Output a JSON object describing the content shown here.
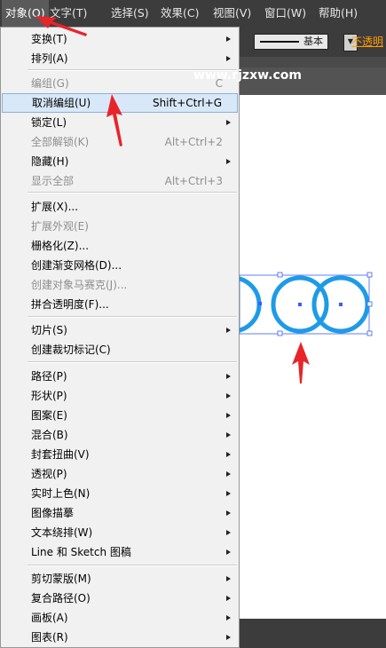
{
  "menubar": {
    "items": [
      "对象(O)",
      "文字(T)",
      "选择(S)",
      "效果(C)",
      "视图(V)",
      "窗口(W)",
      "帮助(H)"
    ]
  },
  "control_bar": {
    "stroke_style": "基本",
    "opacity_label": "不透明"
  },
  "watermark": "www.rjzxw.com",
  "menu": {
    "items": [
      {
        "label": "变换(T)",
        "shortcut": "",
        "submenu": true,
        "disabled": false,
        "highlighted": false
      },
      {
        "label": "排列(A)",
        "shortcut": "",
        "submenu": true,
        "disabled": false,
        "highlighted": false
      },
      {
        "label": "编组(G)",
        "shortcut": "C",
        "submenu": false,
        "disabled": true,
        "highlighted": false
      },
      {
        "label": "取消编组(U)",
        "shortcut": "Shift+Ctrl+G",
        "submenu": false,
        "disabled": false,
        "highlighted": true
      },
      {
        "label": "锁定(L)",
        "shortcut": "",
        "submenu": true,
        "disabled": false,
        "highlighted": false
      },
      {
        "label": "全部解锁(K)",
        "shortcut": "Alt+Ctrl+2",
        "submenu": false,
        "disabled": true,
        "highlighted": false
      },
      {
        "label": "隐藏(H)",
        "shortcut": "",
        "submenu": true,
        "disabled": false,
        "highlighted": false
      },
      {
        "label": "显示全部",
        "shortcut": "Alt+Ctrl+3",
        "submenu": false,
        "disabled": true,
        "highlighted": false
      },
      {
        "label": "扩展(X)...",
        "shortcut": "",
        "submenu": false,
        "disabled": false,
        "highlighted": false
      },
      {
        "label": "扩展外观(E)",
        "shortcut": "",
        "submenu": false,
        "disabled": true,
        "highlighted": false
      },
      {
        "label": "栅格化(Z)...",
        "shortcut": "",
        "submenu": false,
        "disabled": false,
        "highlighted": false
      },
      {
        "label": "创建渐变网格(D)...",
        "shortcut": "",
        "submenu": false,
        "disabled": false,
        "highlighted": false
      },
      {
        "label": "创建对象马赛克(J)...",
        "shortcut": "",
        "submenu": false,
        "disabled": true,
        "highlighted": false
      },
      {
        "label": "拼合透明度(F)...",
        "shortcut": "",
        "submenu": false,
        "disabled": false,
        "highlighted": false
      },
      {
        "label": "切片(S)",
        "shortcut": "",
        "submenu": true,
        "disabled": false,
        "highlighted": false
      },
      {
        "label": "创建裁切标记(C)",
        "shortcut": "",
        "submenu": false,
        "disabled": false,
        "highlighted": false
      },
      {
        "label": "路径(P)",
        "shortcut": "",
        "submenu": true,
        "disabled": false,
        "highlighted": false
      },
      {
        "label": "形状(P)",
        "shortcut": "",
        "submenu": true,
        "disabled": false,
        "highlighted": false
      },
      {
        "label": "图案(E)",
        "shortcut": "",
        "submenu": true,
        "disabled": false,
        "highlighted": false
      },
      {
        "label": "混合(B)",
        "shortcut": "",
        "submenu": true,
        "disabled": false,
        "highlighted": false
      },
      {
        "label": "封套扭曲(V)",
        "shortcut": "",
        "submenu": true,
        "disabled": false,
        "highlighted": false
      },
      {
        "label": "透视(P)",
        "shortcut": "",
        "submenu": true,
        "disabled": false,
        "highlighted": false
      },
      {
        "label": "实时上色(N)",
        "shortcut": "",
        "submenu": true,
        "disabled": false,
        "highlighted": false
      },
      {
        "label": "图像描摹",
        "shortcut": "",
        "submenu": true,
        "disabled": false,
        "highlighted": false
      },
      {
        "label": "文本绕排(W)",
        "shortcut": "",
        "submenu": true,
        "disabled": false,
        "highlighted": false
      },
      {
        "label": "Line 和 Sketch 图稿",
        "shortcut": "",
        "submenu": true,
        "disabled": false,
        "highlighted": false
      },
      {
        "label": "剪切蒙版(M)",
        "shortcut": "",
        "submenu": true,
        "disabled": false,
        "highlighted": false
      },
      {
        "label": "复合路径(O)",
        "shortcut": "",
        "submenu": true,
        "disabled": false,
        "highlighted": false
      },
      {
        "label": "画板(A)",
        "shortcut": "",
        "submenu": true,
        "disabled": false,
        "highlighted": false
      },
      {
        "label": "图表(R)",
        "shortcut": "",
        "submenu": true,
        "disabled": false,
        "highlighted": false
      }
    ]
  },
  "colors": {
    "circle_stroke": "#1e9be6",
    "selection": "#3a5cff",
    "annotation_arrow": "#e8242a",
    "highlight_bg": "#d8e8f8"
  }
}
